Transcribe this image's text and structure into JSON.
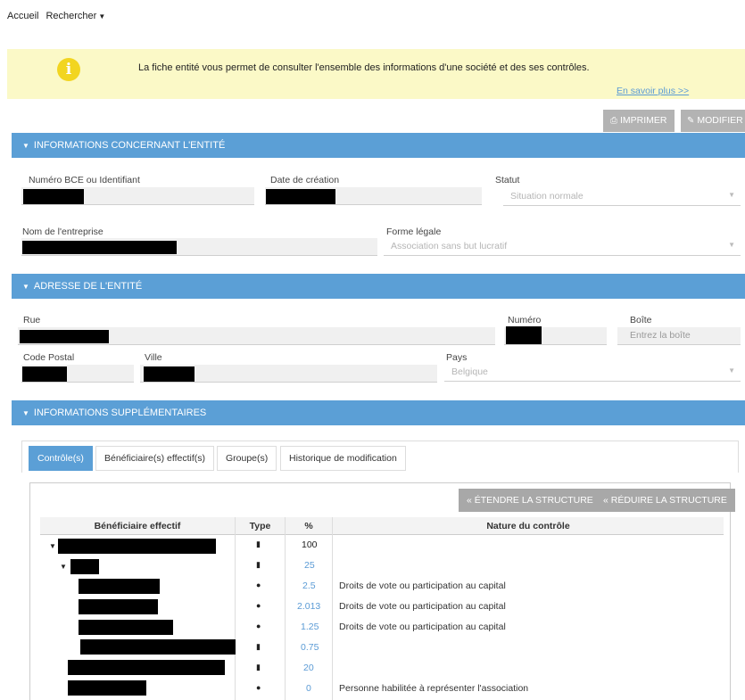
{
  "nav": {
    "home": "Accueil",
    "search": "Rechercher"
  },
  "banner": {
    "text": "La fiche entité vous permet de consulter l'ensemble des informations d'une société et des ses contrôles.",
    "link": "En savoir plus >>"
  },
  "toolbar": {
    "print": "IMPRIMER",
    "edit": "MODIFIER"
  },
  "sections": {
    "entity": "INFORMATIONS CONCERNANT L'ENTITÉ",
    "address": "ADRESSE DE L'ENTITÉ",
    "extra": "INFORMATIONS SUPPLÉMENTAIRES"
  },
  "entity": {
    "bce_label": "Numéro BCE ou Identifiant",
    "created_label": "Date de création",
    "status_label": "Statut",
    "status_value": "Situation normale",
    "name_label": "Nom de l'entreprise",
    "legal_label": "Forme légale",
    "legal_value": "Association sans but lucratif"
  },
  "address": {
    "street_label": "Rue",
    "number_label": "Numéro",
    "box_label": "Boîte",
    "box_placeholder": "Entrez la boîte",
    "postal_label": "Code Postal",
    "city_label": "Ville",
    "country_label": "Pays",
    "country_value": "Belgique"
  },
  "tabs": [
    "Contrôle(s)",
    "Bénéficiaire(s) effectif(s)",
    "Groupe(s)",
    "Historique de modification"
  ],
  "structure": {
    "expand": "« ÉTENDRE LA STRUCTURE",
    "collapse": "« RÉDUIRE LA STRUCTURE"
  },
  "table": {
    "headers": [
      "Bénéficiaire effectif",
      "Type",
      "%",
      "Nature du contrôle"
    ],
    "rows": [
      {
        "pct": "100",
        "nature": "",
        "type": "building-icon"
      },
      {
        "pct": "25",
        "nature": "",
        "type": "building-icon"
      },
      {
        "pct": "2.5",
        "nature": "Droits de vote ou participation au capital",
        "type": "person-icon"
      },
      {
        "pct": "2.013",
        "nature": "Droits de vote ou participation au capital",
        "type": "person-icon"
      },
      {
        "pct": "1.25",
        "nature": "Droits de vote ou participation au capital",
        "type": "person-icon"
      },
      {
        "pct": "0.75",
        "nature": "",
        "type": "building-icon"
      },
      {
        "pct": "20",
        "nature": "",
        "type": "building-icon"
      },
      {
        "pct": "0",
        "nature": "Personne habilitée à représenter l'association",
        "type": "person-icon"
      }
    ]
  },
  "colors": {
    "accent": "#5b9fd6",
    "banner_bg": "#fbf9c7",
    "link": "#5b9bd5",
    "button_gray": "#b3b3b3"
  }
}
